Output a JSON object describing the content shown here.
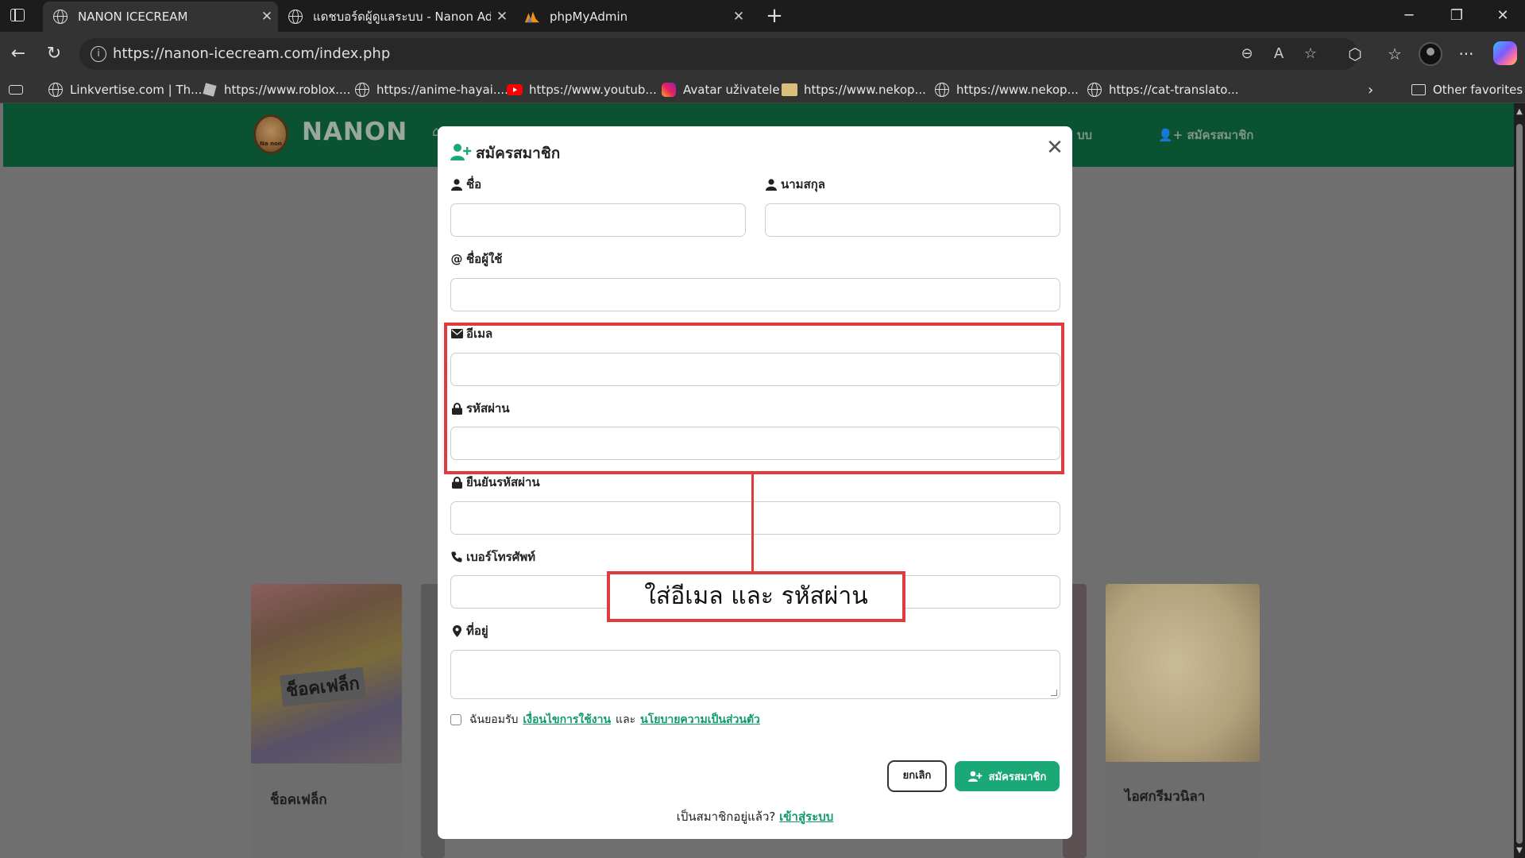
{
  "browser": {
    "tabs": [
      {
        "label": "NANON ICECREAM",
        "icon": "globe-icon",
        "active": true
      },
      {
        "label": "แดชบอร์ดผู้ดูแลระบบ - Nanon Admin",
        "icon": "globe-icon",
        "active": false
      },
      {
        "label": "phpMyAdmin",
        "icon": "phpmyadmin-icon",
        "active": false
      }
    ],
    "url": "https://nanon-icecream.com/index.php",
    "favorites": [
      {
        "label": "Linkvertise.com | Th...",
        "icon": "globe-icon"
      },
      {
        "label": "https://www.roblox....",
        "icon": "roblox-icon"
      },
      {
        "label": "https://anime-hayai....",
        "icon": "globe-icon"
      },
      {
        "label": "https://www.youtub...",
        "icon": "youtube-icon"
      },
      {
        "label": "Avatar uživatele",
        "icon": "instagram-icon"
      },
      {
        "label": "https://www.nekop...",
        "icon": "folder-cat-icon"
      },
      {
        "label": "https://www.nekop...",
        "icon": "globe-icon"
      },
      {
        "label": "https://cat-translato...",
        "icon": "globe-icon"
      }
    ],
    "other_favorites": "Other favorites"
  },
  "site": {
    "brand": "NANON",
    "logo_text": "Na non",
    "nav_partial_login": "บบ",
    "nav_register": "สมัครสมาชิก"
  },
  "products": [
    {
      "name": "ช็อคเฟล็ก",
      "package_label": "ช็อคเฟล็ก"
    },
    {
      "name": "ไอศกรีมวนิลา"
    }
  ],
  "modal": {
    "title": "สมัครสมาชิก",
    "fields": {
      "first_name": "ชื่อ",
      "last_name": "นามสกุล",
      "username": "ชื่อผู้ใช้",
      "email": "อีเมล",
      "password": "รหัสผ่าน",
      "confirm_password": "ยืนยันรหัสผ่าน",
      "phone": "เบอร์โทรศัพท์",
      "address": "ที่อยู่"
    },
    "terms": {
      "prefix": "ฉันยอมรับ",
      "terms_link": "เงื่อนไขการใช้งาน",
      "and": "และ",
      "privacy_link": "นโยบายความเป็นส่วนตัว"
    },
    "cancel_button": "ยกเลิก",
    "register_button": "สมัครสมาชิก",
    "already_member": "เป็นสมาชิกอยู่แล้ว?",
    "login_link": "เข้าสู่ระบบ"
  },
  "annotation": {
    "callout_text": "ใส่อีเมล และ รหัสผ่าน",
    "color": "#e03a3a"
  },
  "colors": {
    "nav_green": "#0b5233",
    "accent_green": "#1aa876",
    "link_green": "#129a6a"
  }
}
